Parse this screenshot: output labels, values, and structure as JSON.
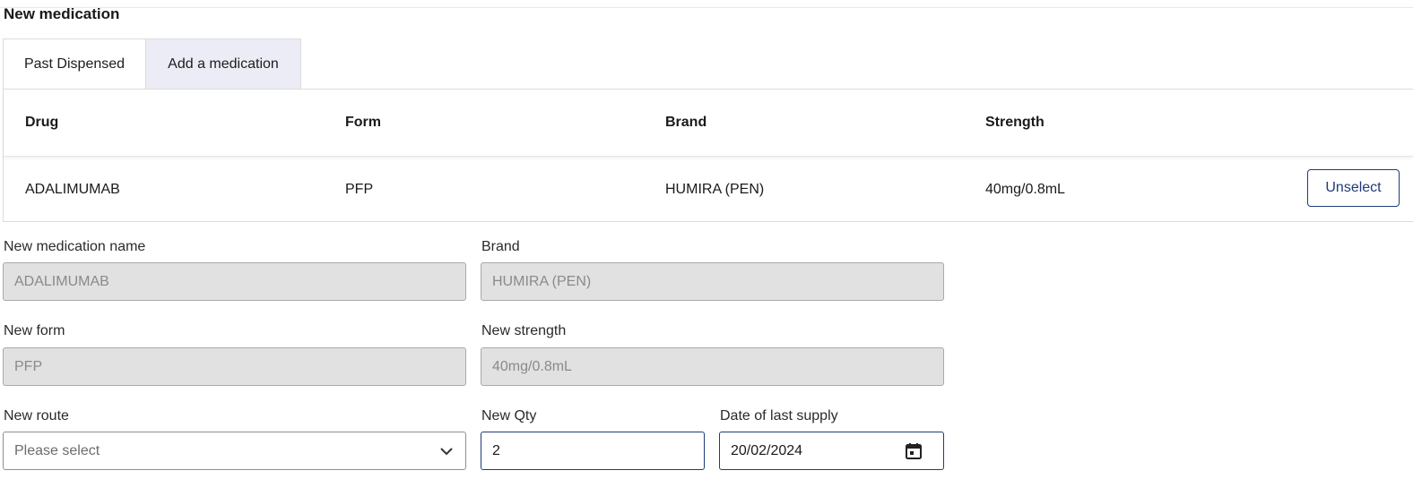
{
  "page": {
    "title": "New medication"
  },
  "tabs": [
    {
      "label": "Past Dispensed",
      "active": true
    },
    {
      "label": "Add a medication",
      "active": false
    }
  ],
  "table": {
    "headers": [
      "Drug",
      "Form",
      "Brand",
      "Strength"
    ],
    "rows": [
      {
        "drug": "ADALIMUMAB",
        "form": "PFP",
        "brand": "HUMIRA (PEN)",
        "strength": "40mg/0.8mL",
        "action": "Unselect"
      }
    ]
  },
  "form": {
    "name": {
      "label": "New medication name",
      "value": "ADALIMUMAB"
    },
    "brand": {
      "label": "Brand",
      "value": "HUMIRA (PEN)"
    },
    "form": {
      "label": "New form",
      "value": "PFP"
    },
    "strength": {
      "label": "New strength",
      "value": "40mg/0.8mL"
    },
    "route": {
      "label": "New route",
      "placeholder": "Please select",
      "icon": "chevron-down-icon"
    },
    "qty": {
      "label": "New Qty",
      "value": "2"
    },
    "date": {
      "label": "Date of last supply",
      "value": "20/02/2024",
      "icon": "calendar-icon"
    }
  },
  "colors": {
    "accent": "#1f3b7a",
    "tab_inactive_bg": "#ececf6",
    "disabled_bg": "#e1e1e1"
  }
}
